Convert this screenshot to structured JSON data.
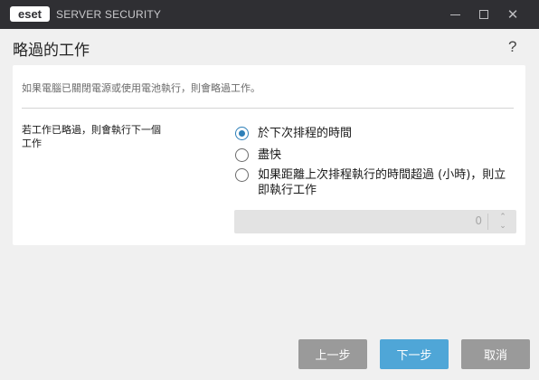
{
  "titlebar": {
    "logo_text": "eset",
    "app_name": "SERVER SECURITY"
  },
  "header": {
    "title": "略過的工作",
    "help_label": "?"
  },
  "main": {
    "description": "如果電腦已關閉電源或使用電池執行，則會略過工作。",
    "setting_label": "若工作已略過，則會執行下一個工作",
    "options": [
      {
        "label": "於下次排程的時間",
        "selected": true
      },
      {
        "label": "盡快",
        "selected": false
      },
      {
        "label": "如果距離上次排程執行的時間超過 (小時)，則立即執行工作",
        "selected": false
      }
    ],
    "hours": {
      "value": "0",
      "up_icon": "chevron-up-icon",
      "down_icon": "chevron-down-icon"
    }
  },
  "footer": {
    "back_label": "上一步",
    "next_label": "下一步",
    "cancel_label": "取消"
  },
  "colors": {
    "titlebar": "#2f2f33",
    "accent": "#2d7fb8",
    "primary_button": "#4fa6d7",
    "secondary_button": "#9a9a9a",
    "background": "#f0f0f0"
  }
}
